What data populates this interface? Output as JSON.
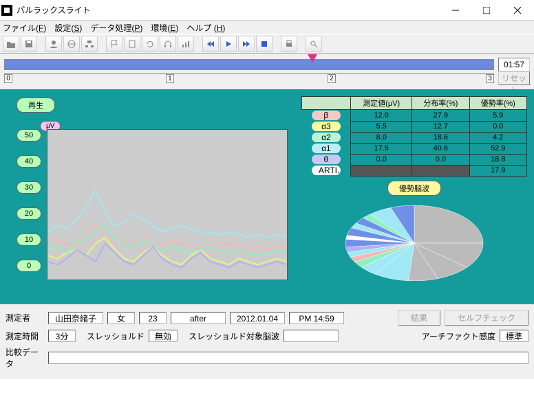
{
  "window": {
    "title": "パルラックスライト"
  },
  "menu": {
    "file": "ファイル(F)",
    "settings": "設定(S)",
    "data": "データ処理(P)",
    "env": "環境(E)",
    "help": "ヘルプ (H)"
  },
  "progress": {
    "time": "01:57",
    "reset": "リセット",
    "ticks": [
      "0",
      "1",
      "2",
      "3"
    ]
  },
  "play_label": "再生",
  "uv_label": "μV",
  "y_ticks": [
    "50",
    "40",
    "30",
    "20",
    "10",
    "0"
  ],
  "table": {
    "headers": [
      "測定値(μV)",
      "分布率(%)",
      "優勢率(%)"
    ],
    "rows": [
      {
        "label": "β",
        "cls": "lbl-beta",
        "v": [
          "12.0",
          "27.9",
          "5.9"
        ]
      },
      {
        "label": "α3",
        "cls": "lbl-a3",
        "v": [
          "5.5",
          "12.7",
          "0.0"
        ]
      },
      {
        "label": "α2",
        "cls": "lbl-a2",
        "v": [
          "8.0",
          "18.6",
          "4.2"
        ]
      },
      {
        "label": "α1",
        "cls": "lbl-a1",
        "v": [
          "17.5",
          "40.6",
          "52.9"
        ]
      },
      {
        "label": "θ",
        "cls": "lbl-theta",
        "v": [
          "0.0",
          "0.0",
          "18.8"
        ]
      },
      {
        "label": "ARTI.",
        "cls": "lbl-arti",
        "v": [
          "",
          "",
          "17.9"
        ],
        "dark": [
          0,
          1
        ]
      }
    ]
  },
  "pie_label": "優勢脳波",
  "bottom": {
    "measurer": "測定者",
    "name": "山田奈緒子",
    "sex": "女",
    "age": "23",
    "phase": "after",
    "date": "2012.01.04",
    "time": "PM 14:59",
    "result_btn": "結果",
    "selfcheck_btn": "セルフチェック",
    "meas_time_lbl": "測定時間",
    "meas_time": "3分",
    "threshold_lbl": "スレッショルド",
    "threshold": "無効",
    "threshold_wave_lbl": "スレッショルド対象脳波",
    "artifact_lbl": "アーチファクト感度",
    "artifact": "標準",
    "compare_lbl": "比較データ"
  },
  "chart_data": {
    "type": "line",
    "ylim": [
      0,
      50
    ],
    "ylabel": "μV",
    "series": [
      {
        "name": "β",
        "color": "#f5b8b8",
        "values": [
          14,
          13,
          12,
          11,
          15,
          18,
          14,
          12,
          13,
          12,
          14,
          12,
          11,
          13,
          12,
          11,
          10,
          12,
          11,
          12,
          11,
          10,
          11,
          10,
          11,
          10
        ]
      },
      {
        "name": "α3",
        "color": "#f0f080",
        "values": [
          8,
          7,
          9,
          10,
          8,
          12,
          14,
          10,
          7,
          6,
          9,
          11,
          8,
          6,
          5,
          8,
          10,
          7,
          6,
          5,
          7,
          6,
          5,
          6,
          7,
          6
        ]
      },
      {
        "name": "α2",
        "color": "#90f0c0",
        "values": [
          10,
          11,
          9,
          12,
          14,
          16,
          18,
          14,
          12,
          11,
          13,
          12,
          10,
          11,
          10,
          9,
          10,
          11,
          10,
          9,
          10,
          9,
          8,
          9,
          10,
          9
        ]
      },
      {
        "name": "α1",
        "color": "#a0e8f5",
        "values": [
          16,
          18,
          17,
          20,
          24,
          30,
          22,
          18,
          19,
          22,
          20,
          18,
          16,
          17,
          18,
          17,
          15,
          16,
          15,
          16,
          15,
          14,
          15,
          14,
          15,
          14
        ]
      },
      {
        "name": "θ",
        "color": "#b0b0f5",
        "values": [
          6,
          5,
          7,
          10,
          8,
          6,
          12,
          9,
          6,
          5,
          8,
          11,
          7,
          5,
          4,
          7,
          9,
          6,
          5,
          4,
          6,
          5,
          4,
          5,
          6,
          5
        ]
      }
    ]
  }
}
